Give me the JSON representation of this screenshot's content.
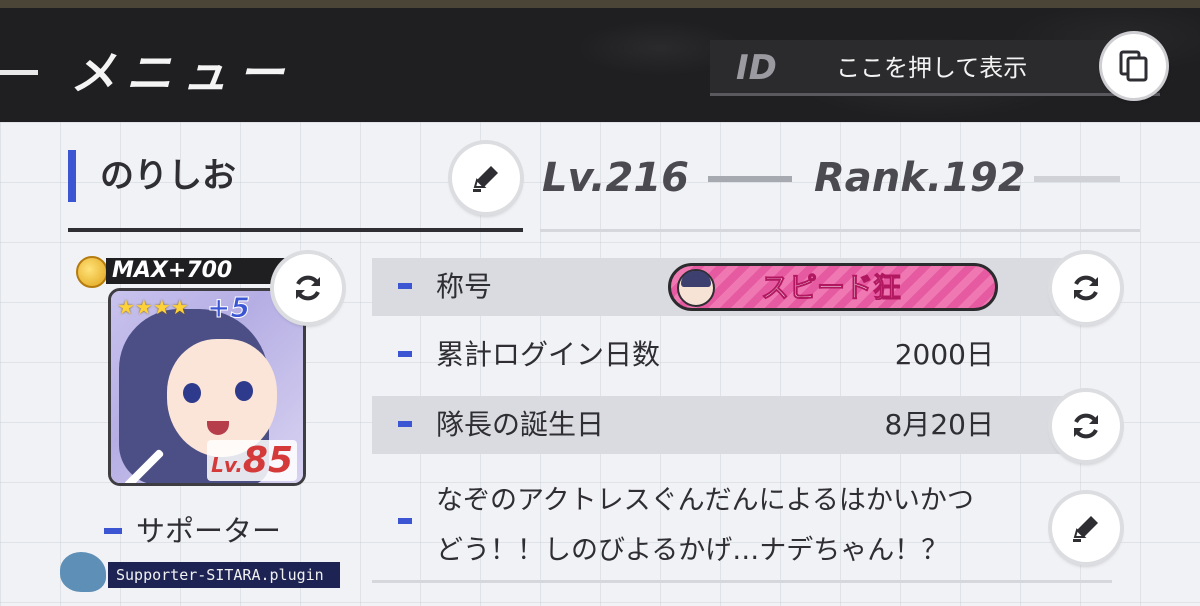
{
  "header": {
    "title": "メニュー",
    "id_label": "ID",
    "id_value": "ここを押して表示",
    "copy_icon": "copy-icon"
  },
  "profile": {
    "name": "のりしお",
    "edit_icon": "pencil-icon",
    "level": "Lv.216",
    "rank": "Rank.192"
  },
  "supporter": {
    "badge": "MAX+700",
    "stars": "★★★★",
    "plus": "+5",
    "level_label": "Lv.",
    "level_value": "85",
    "label": "サポーター",
    "plugin": "Supporter-SITARA.plugin",
    "swap_icon": "refresh-icon"
  },
  "info": {
    "rows": [
      {
        "label": "称号",
        "value": "",
        "badge": "スピード狂"
      },
      {
        "label": "累計ログイン日数",
        "value": "2000日"
      },
      {
        "label": "隊長の誕生日",
        "value": "8月20日"
      }
    ],
    "bio_line1": "なぞのアクトレスぐんだんによるはかいかつ",
    "bio_line2": "どう！！しのびよるかげ…ナデちゃん！？"
  },
  "colors": {
    "accent": "#3b55d3",
    "header_bg": "#1f1f21",
    "badge_pink": "#e55aa0",
    "level_red": "#d53a3a"
  }
}
